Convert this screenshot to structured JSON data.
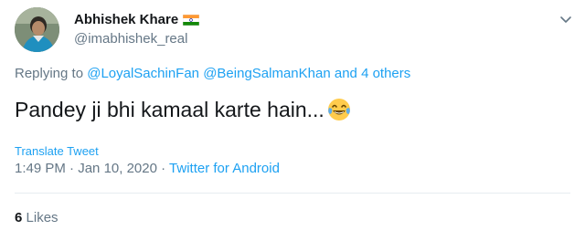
{
  "author": {
    "display_name": "Abhishek Khare",
    "handle": "@imabhishek_real",
    "flag_icon": "india-flag-icon",
    "avatar": "avatar-photo"
  },
  "reply": {
    "prefix": "Replying to",
    "mention_1": "@LoyalSachinFan",
    "mention_2": "@BeingSalmanKhan",
    "connector": "and",
    "others": "4 others"
  },
  "tweet": {
    "text": "Pandey ji bhi kamaal karte hain...",
    "emoji": "face-with-tears-of-joy-icon"
  },
  "translate_label": "Translate Tweet",
  "meta": {
    "time": "1:49 PM",
    "separator": "·",
    "date": "Jan 10, 2020",
    "source": "Twitter for Android"
  },
  "likes": {
    "count": "6",
    "label": "Likes"
  },
  "colors": {
    "link": "#1da1f2",
    "muted": "#657786",
    "text": "#14171a"
  }
}
